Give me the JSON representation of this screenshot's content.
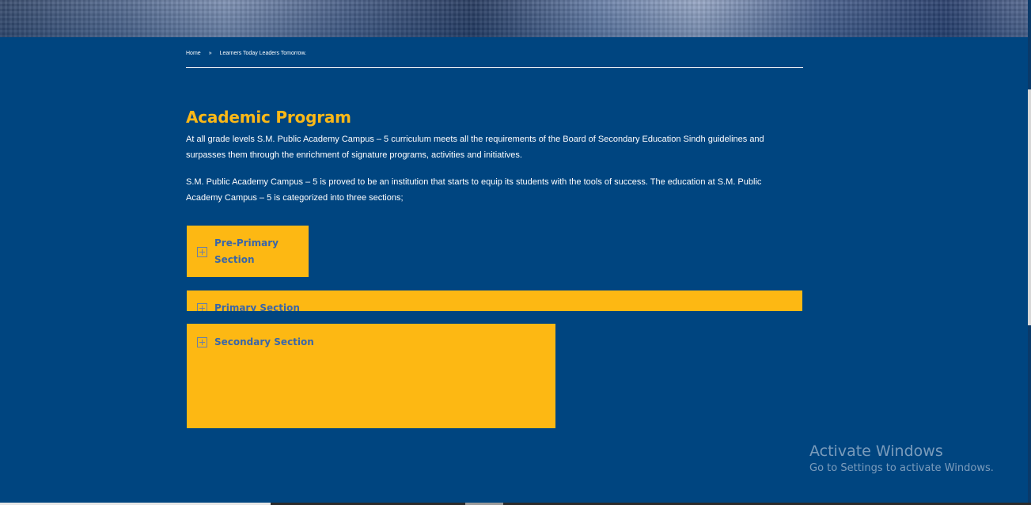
{
  "breadcrumb": {
    "home": "Home",
    "separator": "»",
    "current": "Learners Today Leaders Tomorrow."
  },
  "main": {
    "title": "Academic Program",
    "paragraphs": [
      "At all grade levels S.M. Public Academy Campus – 5 curriculum meets all the requirements of the Board of Secondary Education Sindh guidelines and surpasses them through the enrichment of signature programs, activities and initiatives.",
      "S.M. Public Academy Campus – 5 is proved to be an institution that starts to equip its students with the tools of success. The education at S.M. Public Academy Campus – 5 is categorized into three sections;"
    ],
    "sections": [
      {
        "label": "Pre-Primary Section",
        "icon": "plus-square-icon"
      },
      {
        "label": "Primary Section",
        "icon": "plus-square-icon"
      },
      {
        "label": "Secondary Section",
        "icon": "plus-square-icon"
      }
    ]
  },
  "watermark": {
    "title": "Activate Windows",
    "subtitle": "Go to Settings to activate Windows."
  },
  "colors": {
    "background": "#004580",
    "accent": "#fdb813",
    "title": "#fbb817",
    "section_label": "#3a66a8"
  }
}
